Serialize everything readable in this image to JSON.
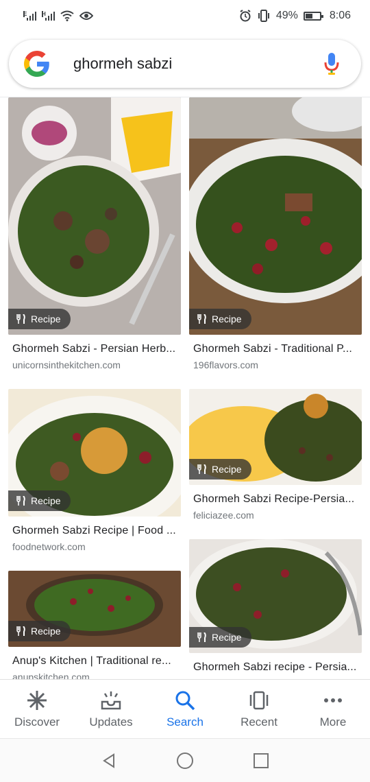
{
  "status_bar": {
    "network_1": "E",
    "network_2": "H",
    "battery_percent": "49%",
    "battery_level": 0.49,
    "time": "8:06"
  },
  "search": {
    "query": "ghormeh sabzi"
  },
  "results": [
    {
      "badge": "Recipe",
      "title": "Ghormeh Sabzi - Persian Herb...",
      "site": "unicornsinthekitchen.com"
    },
    {
      "badge": "Recipe",
      "title": "Ghormeh Sabzi - Traditional P...",
      "site": "196flavors.com"
    },
    {
      "badge": "Recipe",
      "title": "Ghormeh Sabzi Recipe | Food ...",
      "site": "foodnetwork.com"
    },
    {
      "badge": "Recipe",
      "title": "Ghormeh Sabzi Recipe-Persia...",
      "site": "feliciazee.com"
    },
    {
      "badge": "Recipe",
      "title": "Anup's Kitchen | Traditional re...",
      "site": "anupskitchen.com"
    },
    {
      "badge": "Recipe",
      "title": "Ghormeh Sabzi recipe - Persia..."
    }
  ],
  "bottom_nav": {
    "items": [
      {
        "label": "Discover",
        "icon": "asterisk-icon"
      },
      {
        "label": "Updates",
        "icon": "inbox-icon"
      },
      {
        "label": "Search",
        "icon": "search-icon"
      },
      {
        "label": "Recent",
        "icon": "recent-cards-icon"
      },
      {
        "label": "More",
        "icon": "more-dots-icon"
      }
    ],
    "active": "Search"
  },
  "colors": {
    "accent": "#1a73e8",
    "google_blue": "#4285F4",
    "google_red": "#EA4335",
    "google_yellow": "#FBBC05",
    "google_green": "#34A853"
  }
}
